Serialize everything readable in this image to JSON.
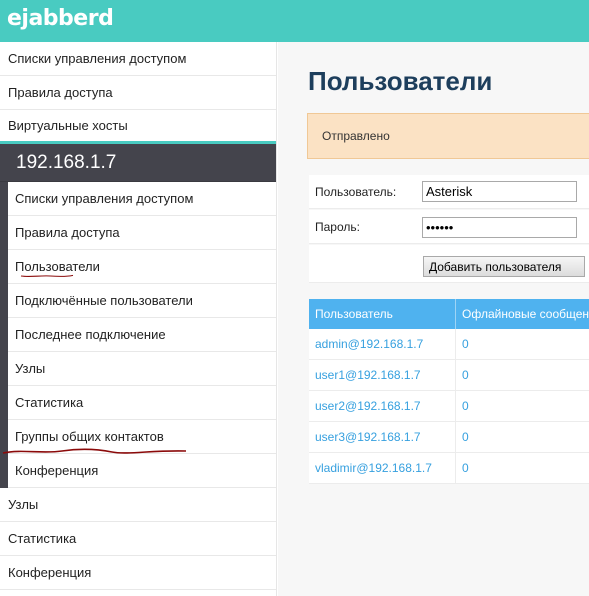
{
  "app": {
    "logo": "ejabberd"
  },
  "sidebar": {
    "top_items": [
      {
        "label": "Списки управления доступом"
      },
      {
        "label": "Правила доступа"
      },
      {
        "label": "Виртуальные хосты"
      }
    ],
    "host": {
      "title": "192.168.1.7",
      "items": [
        {
          "label": "Списки управления доступом"
        },
        {
          "label": "Правила доступа"
        },
        {
          "label": "Пользователи"
        },
        {
          "label": "Подключённые пользователи"
        },
        {
          "label": "Последнее подключение"
        },
        {
          "label": "Узлы"
        },
        {
          "label": "Статистика"
        },
        {
          "label": "Группы общих контактов"
        },
        {
          "label": "Конференция"
        }
      ]
    },
    "bottom_items": [
      {
        "label": "Узлы"
      },
      {
        "label": "Статистика"
      },
      {
        "label": "Конференция"
      }
    ]
  },
  "main": {
    "title": "Пользователи",
    "notice": "Отправлено",
    "form": {
      "user_label": "Пользователь:",
      "user_value": "Asterisk",
      "password_label": "Пароль:",
      "password_value": "aaaaaa",
      "add_button": "Добавить пользователя"
    },
    "table": {
      "headers": [
        "Пользователь",
        "Офлайновые сообщения"
      ],
      "rows": [
        [
          "admin@192.168.1.7",
          "0"
        ],
        [
          "user1@192.168.1.7",
          "0"
        ],
        [
          "user2@192.168.1.7",
          "0"
        ],
        [
          "user3@192.168.1.7",
          "0"
        ],
        [
          "vladimir@192.168.1.7",
          "0"
        ]
      ]
    }
  },
  "colors": {
    "header": "#49cbc1",
    "host_block": "#44444c",
    "notice_bg": "#fbe2c4",
    "table_header": "#4fb2ef",
    "link": "#36a0df",
    "annotation": "#8b0a0a"
  }
}
